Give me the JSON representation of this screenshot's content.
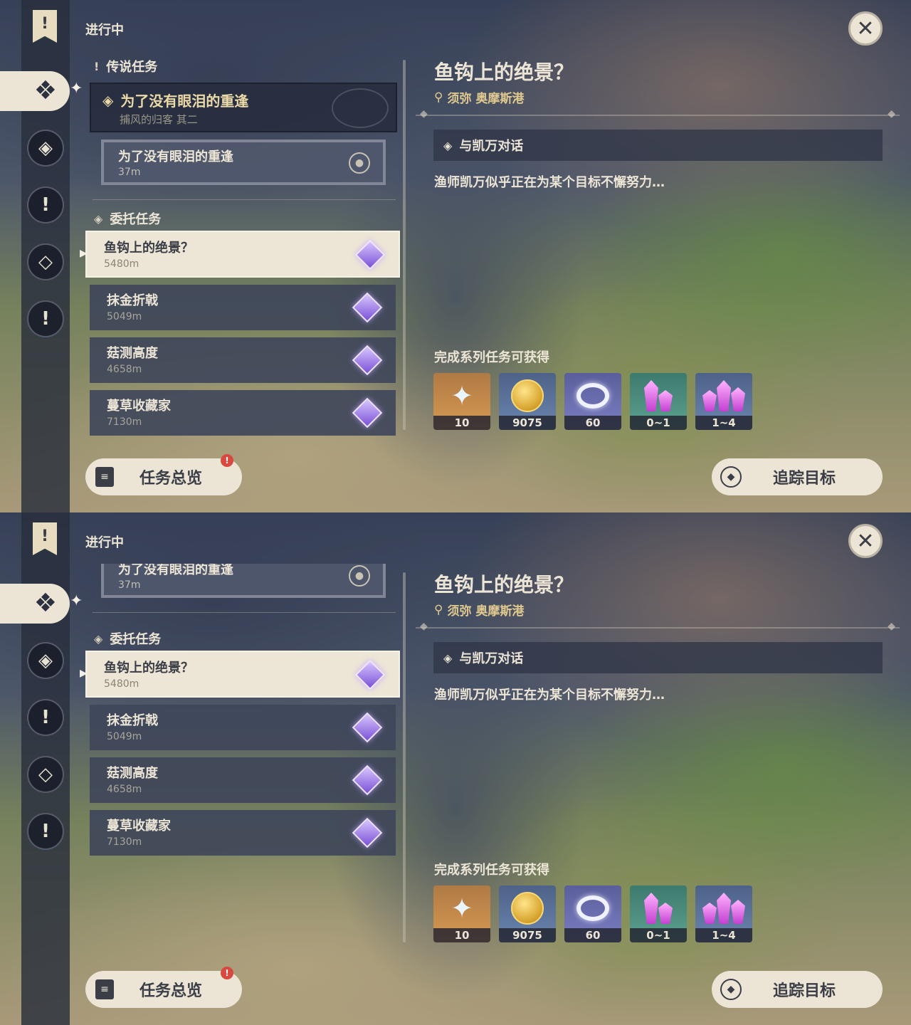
{
  "status_title": "进行中",
  "sections": {
    "legend": "传说任务",
    "commission": "委托任务"
  },
  "legend_quest": {
    "title": "为了没有眼泪的重逢",
    "subtitle": "捕风的归客 其二"
  },
  "legend_sub": {
    "title": "为了没有眼泪的重逢",
    "distance": "37m"
  },
  "tasks": [
    {
      "title": "鱼钩上的绝景？",
      "distance": "5480m"
    },
    {
      "title": "抹金折戟",
      "distance": "5049m"
    },
    {
      "title": "菇测高度",
      "distance": "4658m"
    },
    {
      "title": "蔓草收藏家",
      "distance": "7130m"
    }
  ],
  "overview_button": {
    "label": "任务总览",
    "badge": "!"
  },
  "detail": {
    "title": "鱼钩上的绝景？",
    "location": "须弥 奥摩斯港",
    "objective": "与凯万对话",
    "description": "渔师凯万似乎正在为某个目标不懈努力…",
    "rewards_label": "完成系列任务可获得",
    "rewards": [
      {
        "icon": "primogem-icon",
        "count": "10"
      },
      {
        "icon": "mora-icon",
        "count": "9075"
      },
      {
        "icon": "companionship-exp-icon",
        "count": "60"
      },
      {
        "icon": "crystal-chunk-icon",
        "count": "0~1"
      },
      {
        "icon": "crystal-ore-icon",
        "count": "1~4"
      }
    ]
  },
  "track_button": {
    "label": "追踪目标"
  },
  "close_label": "✕",
  "colors": {
    "panel_cream": "#ece5d6",
    "gold_text": "#e0c98f",
    "dark_slot": "#3e465a",
    "badge_red": "#d84a3f"
  }
}
